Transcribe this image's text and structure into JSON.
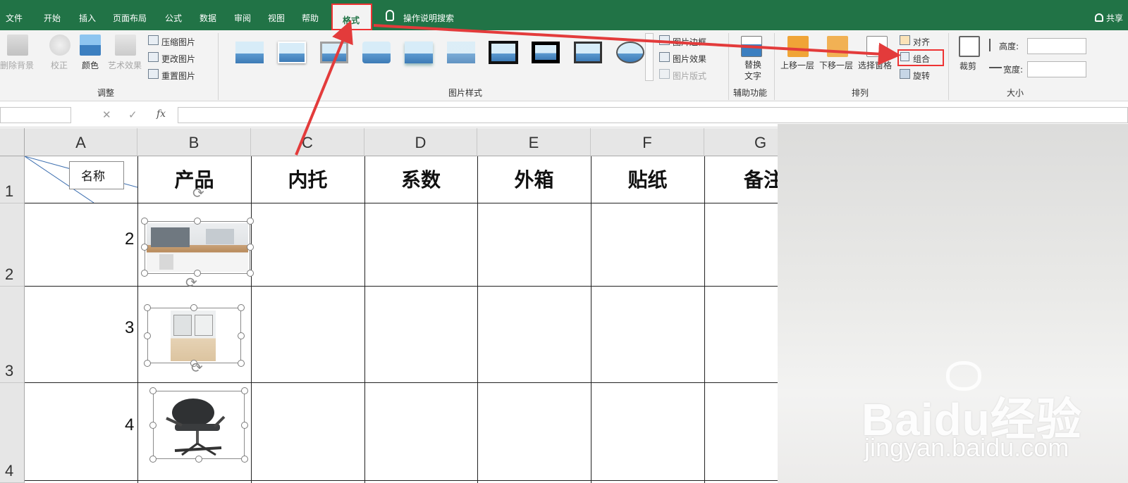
{
  "menubar": {
    "items": [
      "文件",
      "开始",
      "插入",
      "页面布局",
      "公式",
      "数据",
      "审阅",
      "视图",
      "帮助"
    ],
    "active_tab": "格式",
    "search": "操作说明搜索",
    "share": "共享"
  },
  "ribbon": {
    "adjust": {
      "remove_bg": "删除背景",
      "correct": "校正",
      "color": "颜色",
      "art_effect": "艺术效果",
      "compress": "压缩图片",
      "change": "更改图片",
      "reset": "重置图片",
      "group_label": "调整"
    },
    "styles": {
      "border": "图片边框",
      "effect": "图片效果",
      "layout": "图片版式",
      "group_label": "图片样式"
    },
    "alt": {
      "replace": "替换",
      "text": "文字",
      "group_label": "辅助功能"
    },
    "arrange": {
      "forward": "上移一层",
      "backward": "下移一层",
      "pane": "选择窗格",
      "align": "对齐",
      "group": "组合",
      "rotate": "旋转",
      "group_label": "排列"
    },
    "size": {
      "crop": "裁剪",
      "height": "高度:",
      "width": "宽度:",
      "group_label": "大小"
    }
  },
  "formula": {
    "fx": "fx"
  },
  "sheet": {
    "columns": [
      "A",
      "B",
      "C",
      "D",
      "E",
      "F",
      "G"
    ],
    "rows": [
      "1",
      "2",
      "3",
      "4"
    ],
    "corner_label": "名称",
    "headers": [
      "产品",
      "内托",
      "系数",
      "外箱",
      "贴纸",
      "备注"
    ],
    "row_values": [
      "2",
      "3",
      "4"
    ]
  },
  "watermark": {
    "logo": "Baidu经验",
    "url": "jingyan.baidu.com"
  },
  "colors": {
    "excel_green": "#217346",
    "highlight": "#e33b3b"
  }
}
